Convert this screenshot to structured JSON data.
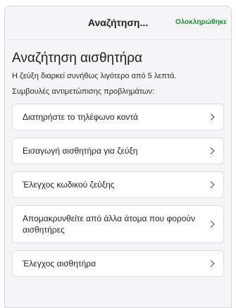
{
  "header": {
    "title": "Αναζήτηση...",
    "done_label": "Ολοκληρώθηκε"
  },
  "main": {
    "title": "Αναζήτηση αισθητήρα",
    "subtitle": "Η ζεύξη διαρκεί συνήθως λιγότερο από 5 λεπτά.",
    "tips_heading": "Συμβουλές αντιμετώπισης προβλημάτων:",
    "tips": [
      {
        "label": "Διατηρήστε το τηλέφωνο κοντά",
        "icon": "chevron-right-icon"
      },
      {
        "label": "Εισαγωγή αισθητήρα για ζεύξη",
        "icon": "chevron-right-icon"
      },
      {
        "label": "Έλεγχος κωδικού ζεύξης",
        "icon": "chevron-right-icon"
      },
      {
        "label": "Απομακρυνθείτε από άλλα άτομα που φορούν αισθητήρες",
        "icon": "chevron-right-icon"
      },
      {
        "label": "Έλεγχος αισθητήρα",
        "icon": "chevron-right-icon"
      }
    ]
  },
  "colors": {
    "accent": "#1f8a3a",
    "background": "#f5f5f7",
    "card": "#ffffff"
  }
}
